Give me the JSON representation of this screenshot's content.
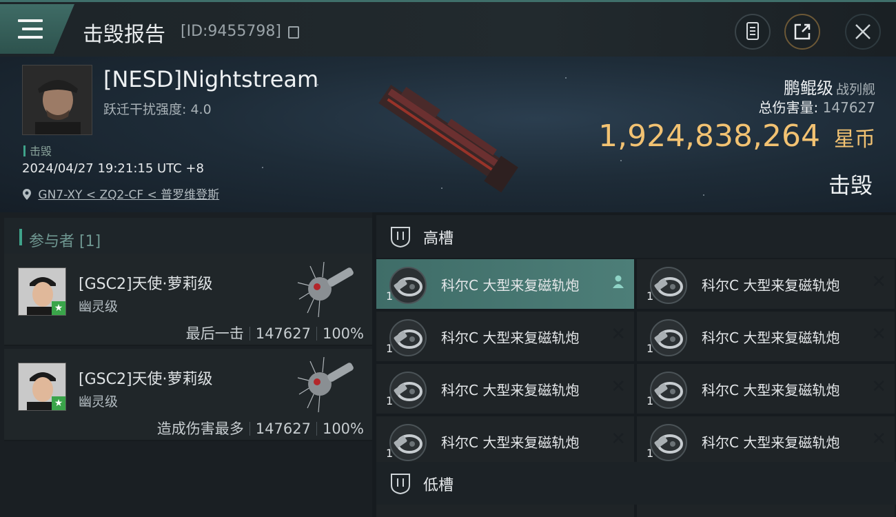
{
  "topbar": {
    "title": "击毁报告",
    "id_label": "[ID:9455798]",
    "icons": [
      "menu-icon",
      "clipboard-icon",
      "share-icon",
      "close-icon"
    ]
  },
  "victim": {
    "name": "[NESD]Nightstream",
    "warp_label": "跃迁干扰强度: 4.0",
    "status": "击毁",
    "datetime": "2024/04/27 19:21:15 UTC +8",
    "location": "GN7-XY < ZQ2-CF < 普罗维登斯",
    "ship_name": "鹏鲲级",
    "ship_type": "战列舰",
    "damage_label": "总伤害量:",
    "damage_value": "147627",
    "isk_value": "1,924,838,264",
    "isk_unit": "星币",
    "result": "击毁"
  },
  "participants": {
    "header": "参与者 [1]",
    "items": [
      {
        "name": "[GSC2]天使·萝莉级",
        "ship": "幽灵级",
        "role": "最后一击",
        "damage": "147627",
        "percent": "100%"
      },
      {
        "name": "[GSC2]天使·萝莉级",
        "ship": "幽灵级",
        "role": "造成伤害最多",
        "damage": "147627",
        "percent": "100%"
      }
    ]
  },
  "slots": {
    "high_label": "高槽",
    "low_label": "低槽",
    "high_modules": [
      {
        "name": "科尔C 大型来复磁轨炮",
        "qty": "1",
        "state": "user"
      },
      {
        "name": "科尔C 大型来复磁轨炮",
        "qty": "1",
        "state": "destroyed"
      },
      {
        "name": "科尔C 大型来复磁轨炮",
        "qty": "1",
        "state": "destroyed"
      },
      {
        "name": "科尔C 大型来复磁轨炮",
        "qty": "1",
        "state": "destroyed"
      },
      {
        "name": "科尔C 大型来复磁轨炮",
        "qty": "1",
        "state": "destroyed"
      },
      {
        "name": "科尔C 大型来复磁轨炮",
        "qty": "1",
        "state": "destroyed"
      },
      {
        "name": "科尔C 大型来复磁轨炮",
        "qty": "1",
        "state": "destroyed"
      },
      {
        "name": "科尔C 大型来复磁轨炮",
        "qty": "1",
        "state": "destroyed"
      }
    ],
    "x_glyph": "✕"
  },
  "colors": {
    "accent": "#3fa38a",
    "isk": "#f2c272",
    "active_row": "#4d7e78"
  }
}
